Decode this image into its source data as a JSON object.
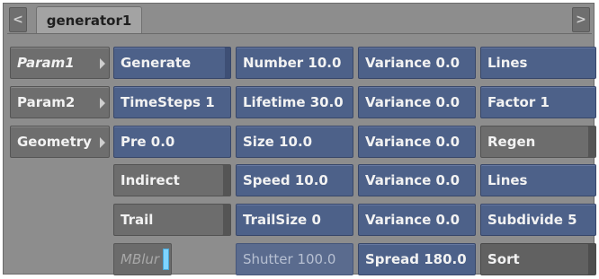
{
  "tabs": {
    "left_arrow": "<",
    "right_arrow": ">",
    "active_tab": "generator1"
  },
  "nav": [
    {
      "label": "Param1"
    },
    {
      "label": "Param2"
    },
    {
      "label": "Geometry"
    }
  ],
  "col1": {
    "generate": "Generate",
    "timesteps": "TimeSteps 1",
    "pre": "Pre 0.0",
    "indirect": "Indirect",
    "trail": "Trail",
    "mblur": "MBlur"
  },
  "col2": {
    "number": "Number 10.0",
    "lifetime": "Lifetime 30.0",
    "size": "Size 10.0",
    "speed": "Speed 10.0",
    "trailsize": "TrailSize 0",
    "shutter": "Shutter 100.0"
  },
  "col3": {
    "variance1": "Variance 0.0",
    "variance2": "Variance 0.0",
    "variance3": "Variance 0.0",
    "variance4": "Variance 0.0",
    "variance5": "Variance 0.0",
    "spread": "Spread 180.0"
  },
  "col4": {
    "lines1": "Lines",
    "factor": "Factor 1",
    "regen": "Regen",
    "lines2": "Lines",
    "subdivide": "Subdivide 5",
    "sort": "Sort"
  }
}
